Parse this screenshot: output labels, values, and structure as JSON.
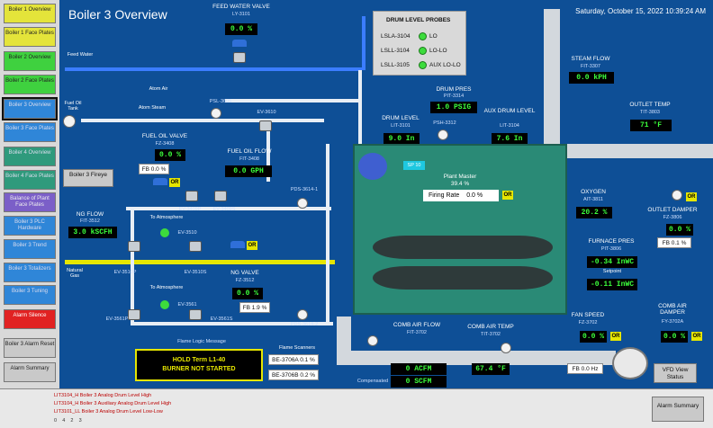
{
  "title": "Boiler 3 Overview",
  "datetime": "Saturday, October 15, 2022 10:39:24 AM",
  "sidebar": {
    "items": [
      {
        "label": "Boiler 1 Overview",
        "color": "yellow"
      },
      {
        "label": "Boiler 1 Face Plates",
        "color": "yellow"
      },
      {
        "label": "Boiler 2 Overview",
        "color": "green"
      },
      {
        "label": "Boiler 2 Face Plates",
        "color": "green"
      },
      {
        "label": "Boiler 3 Overview",
        "color": "blue"
      },
      {
        "label": "Boiler 3 Face Plates",
        "color": "blue"
      },
      {
        "label": "Boiler 4 Overview",
        "color": "teal"
      },
      {
        "label": "Boiler 4 Face Plates",
        "color": "teal"
      },
      {
        "label": "Balance of Plant Face Plates",
        "color": "purple"
      },
      {
        "label": "Boiler 3 PLC Hardware",
        "color": "blue"
      },
      {
        "label": "Boiler 3 Trend",
        "color": "blue"
      },
      {
        "label": "Boiler 3 Totalizers",
        "color": "blue"
      },
      {
        "label": "Boiler 3 Tuning",
        "color": "blue"
      },
      {
        "label": "Alarm Silence",
        "color": "red"
      },
      {
        "label": "Boiler 3 Alarm Reset",
        "color": "gray"
      },
      {
        "label": "Alarm Summary",
        "color": "gray"
      }
    ]
  },
  "feedwater": {
    "title": "FEED WATER VALVE",
    "tag": "LY-3101",
    "value": "0.0 %",
    "line_label": "Feed Water"
  },
  "drum_probes": {
    "title": "DRUM LEVEL PROBES",
    "rows": [
      {
        "tag": "LSLA-3104",
        "state": "LO"
      },
      {
        "tag": "LSLL-3104",
        "state": "LO-LO"
      },
      {
        "tag": "LSLL-3105",
        "state": "AUX LO-LO"
      }
    ]
  },
  "steam_flow": {
    "title": "STEAM FLOW",
    "tag": "FIT-3307",
    "value": "0.0 kPH"
  },
  "outlet_temp": {
    "title": "OUTLET TEMP",
    "tag": "TIT-3803",
    "value": "71 °F"
  },
  "drum_pres": {
    "title": "DRUM PRES",
    "tag": "PIT-3314",
    "value": "1.0 PSIG"
  },
  "drum_level": {
    "title": "DRUM LEVEL",
    "tag": "LIT-3101",
    "value": "9.0 In"
  },
  "aux_drum_level": {
    "title": "AUX DRUM LEVEL",
    "tag": "LIT-3104",
    "value": "7.6 In"
  },
  "psh_tag": "PSH-3312",
  "atom_air": "Atom Air",
  "atom_steam": "Atom Steam",
  "psl_tag": "PSL-3605",
  "fuel_oil_tank": "Fuel Oil Tank",
  "ev3610": "EV-3610",
  "fuel_oil_valve": {
    "title": "FUEL OIL VALVE",
    "tag": "FZ-3408",
    "value": "0.0 %",
    "fb": "FB 0.0 %"
  },
  "fuel_oil_flow": {
    "title": "FUEL OIL FLOW",
    "tag": "FIT-3408",
    "value": "0.0 GPH"
  },
  "ev3409p": "EV-3409P",
  "ev3409s": "EV-3409S",
  "boiler_fireye": "Boiler 3 Fireye",
  "plant_master": {
    "label": "Plant Master",
    "value": "39.4 %",
    "sp": "SP 10"
  },
  "firing_rate": {
    "label": "Firing Rate",
    "value": "0.0 %"
  },
  "pds1": "PDS-3614-1",
  "pds2": "PDS-3614-2",
  "ng_flow": {
    "title": "NG FLOW",
    "tag": "FIT-3512",
    "value": "3.0 kSCFH"
  },
  "to_atmosphere1": "To Atmosphere",
  "to_atmosphere2": "To Atmosphere",
  "ev3510": "EV-3510",
  "ev3510p": "EV-3510P",
  "ev3510s": "EV-3510S",
  "natural_gas": "Natural Gas",
  "ng_valve": {
    "title": "NG VALVE",
    "tag": "FZ-3512",
    "value": "0.0 %",
    "fb": "FB 1.9 %"
  },
  "ev3561p": "EV-3561P",
  "ev3561": "EV-3561",
  "ev3561s": "EV-3561S",
  "flame_msg_label": "Flame Logic Message",
  "status": {
    "line1": "HOLD   Term L1-40",
    "line2": "BURNER NOT STARTED"
  },
  "flame_scanners": {
    "title": "Flame Scanners",
    "a": "BE-3706A  0.1 %",
    "b": "BE-3706B  0.2 %"
  },
  "oxygen": {
    "title": "OXYGEN",
    "tag": "AIT-3811",
    "value": "20.2 %"
  },
  "outlet_damper": {
    "title": "OUTLET DAMPER",
    "tag": "FZ-3806",
    "value": "0.0 %",
    "fb": "FB 0.1 %"
  },
  "furnace_pres": {
    "title": "FURNACE PRES",
    "tag": "PIT-3806",
    "value": "-0.34 InWC",
    "setpoint_label": "Setpoint",
    "setpoint": "-0.11 InWC"
  },
  "fan_speed": {
    "title": "FAN SPEED",
    "tag": "FZ-3702",
    "value": "0.0 %",
    "fb": "FB 0.0 Hz"
  },
  "comb_air_damper": {
    "title": "COMB AIR DAMPER",
    "tag": "FY-3702A",
    "value": "0.0 %"
  },
  "comb_air_flow": {
    "title": "COMB AIR FLOW",
    "tag": "FIT-3702",
    "value1": "0 ACFM",
    "value2": "0 SCFM",
    "compensated": "Compensated"
  },
  "comb_air_temp": {
    "title": "COMB AIR TEMP",
    "tag": "TIT-3702",
    "value": "67.4 °F"
  },
  "vfd_status": "VFD View Status",
  "or_label": "OR",
  "alarm_bar": {
    "lines": [
      "LIT3104_H Boiler 3 Analog Drum Level High",
      "LIT3104_H Boiler 3 Auxiliary Analog Drum Level High",
      "LIT3101_LL Boiler 3 Analog Drum Level Low-Low"
    ],
    "counts": [
      "0",
      "4",
      "2",
      "3"
    ],
    "summary_button": "Alarm Summary"
  }
}
